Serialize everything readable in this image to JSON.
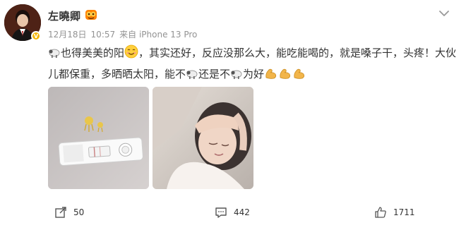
{
  "user": {
    "name": "左曉卿",
    "icon": "user-avatar",
    "verified_icon": "verified-badge-icon",
    "level_badge_icon": "member-badge-icon"
  },
  "meta": {
    "date": "12月18日",
    "time": "10:57",
    "source": "来自 iPhone 13 Pro"
  },
  "post": {
    "segments": [
      {
        "type": "emoji",
        "name": "sheep-emoji"
      },
      {
        "type": "text",
        "value": "也得美美的阳"
      },
      {
        "type": "emoji",
        "name": "smile-emoji"
      },
      {
        "type": "text",
        "value": "，其实还好，反应没那么大，能吃能喝的，就是嗓子干，头疼！大伙儿都保重，多晒晒太阳，能不"
      },
      {
        "type": "emoji",
        "name": "sheep-emoji"
      },
      {
        "type": "text",
        "value": "还是不"
      },
      {
        "type": "emoji",
        "name": "sheep-emoji"
      },
      {
        "type": "text",
        "value": "为好"
      },
      {
        "type": "emoji",
        "name": "strong-arm-emoji"
      },
      {
        "type": "emoji",
        "name": "strong-arm-emoji"
      },
      {
        "type": "emoji",
        "name": "strong-arm-emoji"
      }
    ]
  },
  "photos": [
    {
      "name": "antigen-test-photo"
    },
    {
      "name": "selfie-photo"
    }
  ],
  "actions": {
    "repost": {
      "icon": "repost-icon",
      "count": "50"
    },
    "comment": {
      "icon": "comment-icon",
      "count": "442"
    },
    "like": {
      "icon": "thumbs-up-icon",
      "count": "1711"
    }
  },
  "colors": {
    "text": "#333333",
    "meta": "#939393",
    "verified": "#f5b400"
  }
}
